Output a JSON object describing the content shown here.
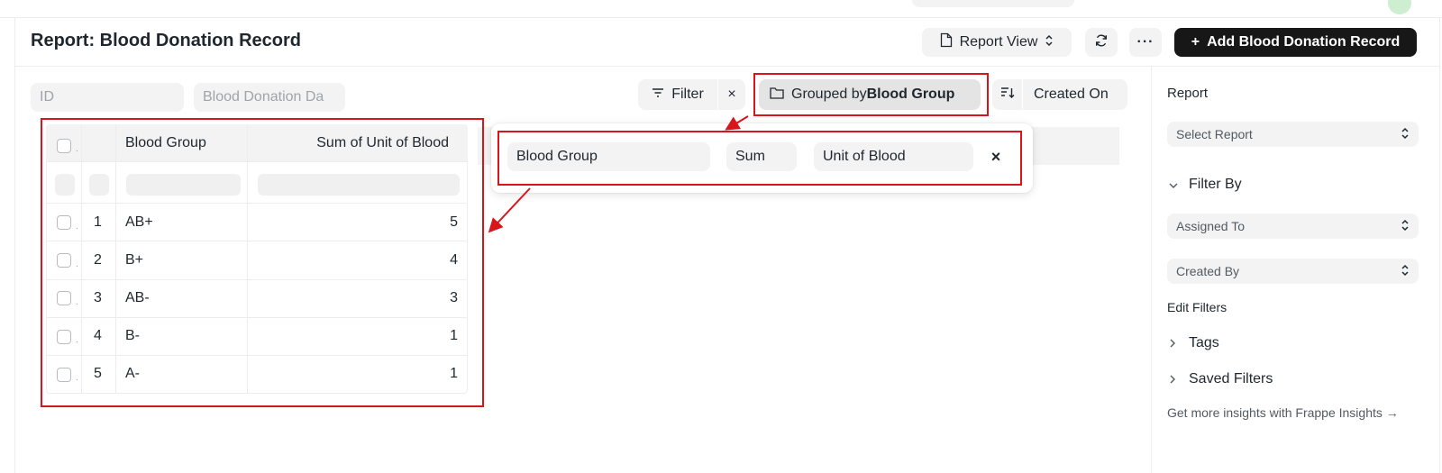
{
  "page": {
    "title": "Report: Blood Donation Record"
  },
  "toolbar": {
    "report_view_label": "Report View",
    "more_label": "···",
    "primary_label": "Add Blood Donation Record",
    "primary_icon": "+"
  },
  "filters": {
    "id_placeholder": "ID",
    "date_placeholder": "Blood Donation Da",
    "filter_label": "Filter",
    "clear_label": "×",
    "group_prefix": "Grouped by",
    "group_field": "Blood Group",
    "sort_field": "Created On"
  },
  "group_popover": {
    "group_by": "Blood Group",
    "aggregate": "Sum",
    "of_field": "Unit of Blood",
    "close_label": "×"
  },
  "table": {
    "columns": [
      "Blood Group",
      "Sum of Unit of Blood"
    ],
    "rows": [
      {
        "index": "1",
        "group": "AB+",
        "sum": "5"
      },
      {
        "index": "2",
        "group": "B+",
        "sum": "4"
      },
      {
        "index": "3",
        "group": "AB-",
        "sum": "3"
      },
      {
        "index": "4",
        "group": "B-",
        "sum": "1"
      },
      {
        "index": "5",
        "group": "A-",
        "sum": "1"
      }
    ]
  },
  "sidebar": {
    "report_label": "Report",
    "select_report": "Select Report",
    "filter_by": "Filter By",
    "assigned_to": "Assigned To",
    "created_by": "Created By",
    "edit_filters": "Edit Filters",
    "tags": "Tags",
    "saved_filters": "Saved Filters",
    "insights": "Get more insights with Frappe Insights →"
  },
  "colors": {
    "annotation": "#d9151c",
    "primary_button": "#171717",
    "control_bg": "#f3f3f3"
  }
}
